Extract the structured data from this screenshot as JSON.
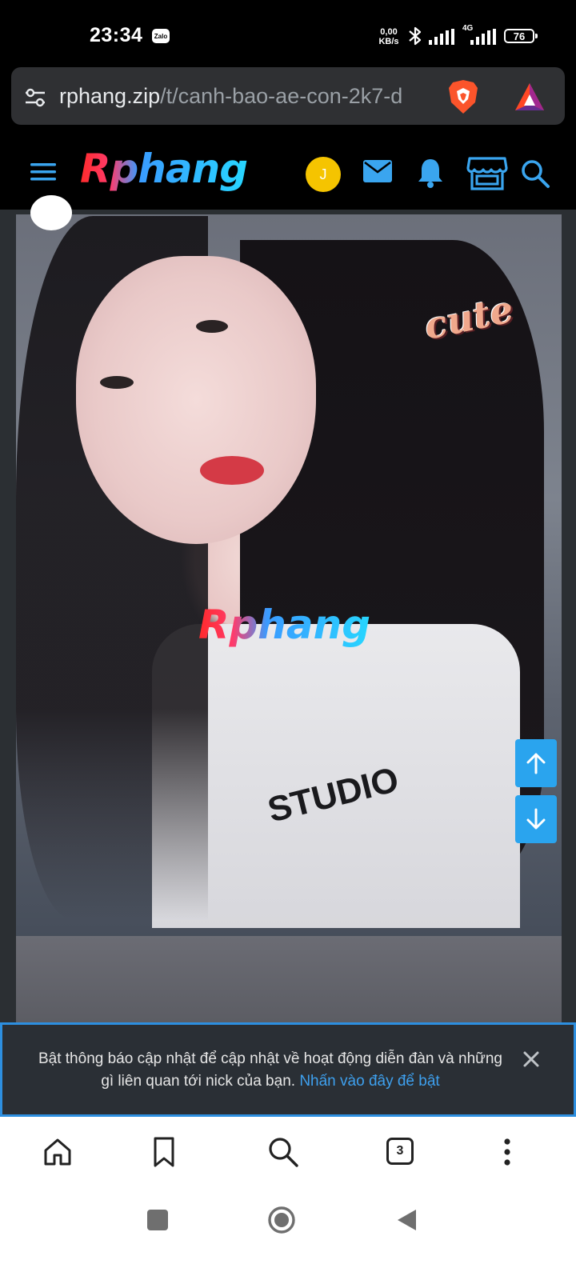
{
  "status_bar": {
    "time": "23:34",
    "zalo_label": "Zalo",
    "net_speed_value": "0,00",
    "net_speed_unit": "KB/s",
    "network_type": "4G",
    "battery": "76",
    "icons": [
      "zalo-icon",
      "bluetooth-icon",
      "signal-icon",
      "signal-4g-icon",
      "battery-icon"
    ]
  },
  "url_bar": {
    "host": "rphang.zip",
    "path": "/t/canh-bao-ae-con-2k7-d",
    "icons": [
      "tune-icon",
      "brave-shield-icon",
      "brave-rewards-icon"
    ]
  },
  "header": {
    "logo": "Rphang",
    "avatar_letter": "J",
    "icons": [
      "menu-icon",
      "mail-icon",
      "bell-icon",
      "store-icon",
      "search-icon"
    ],
    "accent": "#2aa4ee"
  },
  "post": {
    "watermark": "Rphang",
    "sticker": "cute",
    "shirt_text": "STUDIO"
  },
  "notice": {
    "text": "Bật thông báo cập nhật để cập nhật về hoạt động diễn đàn và những gì liên quan tới nick của bạn.",
    "link": "Nhấn vào đây để bật"
  },
  "toolbar": {
    "tab_count": "3",
    "icons": [
      "home-icon",
      "bookmark-icon",
      "search-icon",
      "tabs-icon",
      "more-icon"
    ]
  },
  "navbar": {
    "icons": [
      "recent-apps-icon",
      "home-button-icon",
      "back-icon"
    ]
  }
}
